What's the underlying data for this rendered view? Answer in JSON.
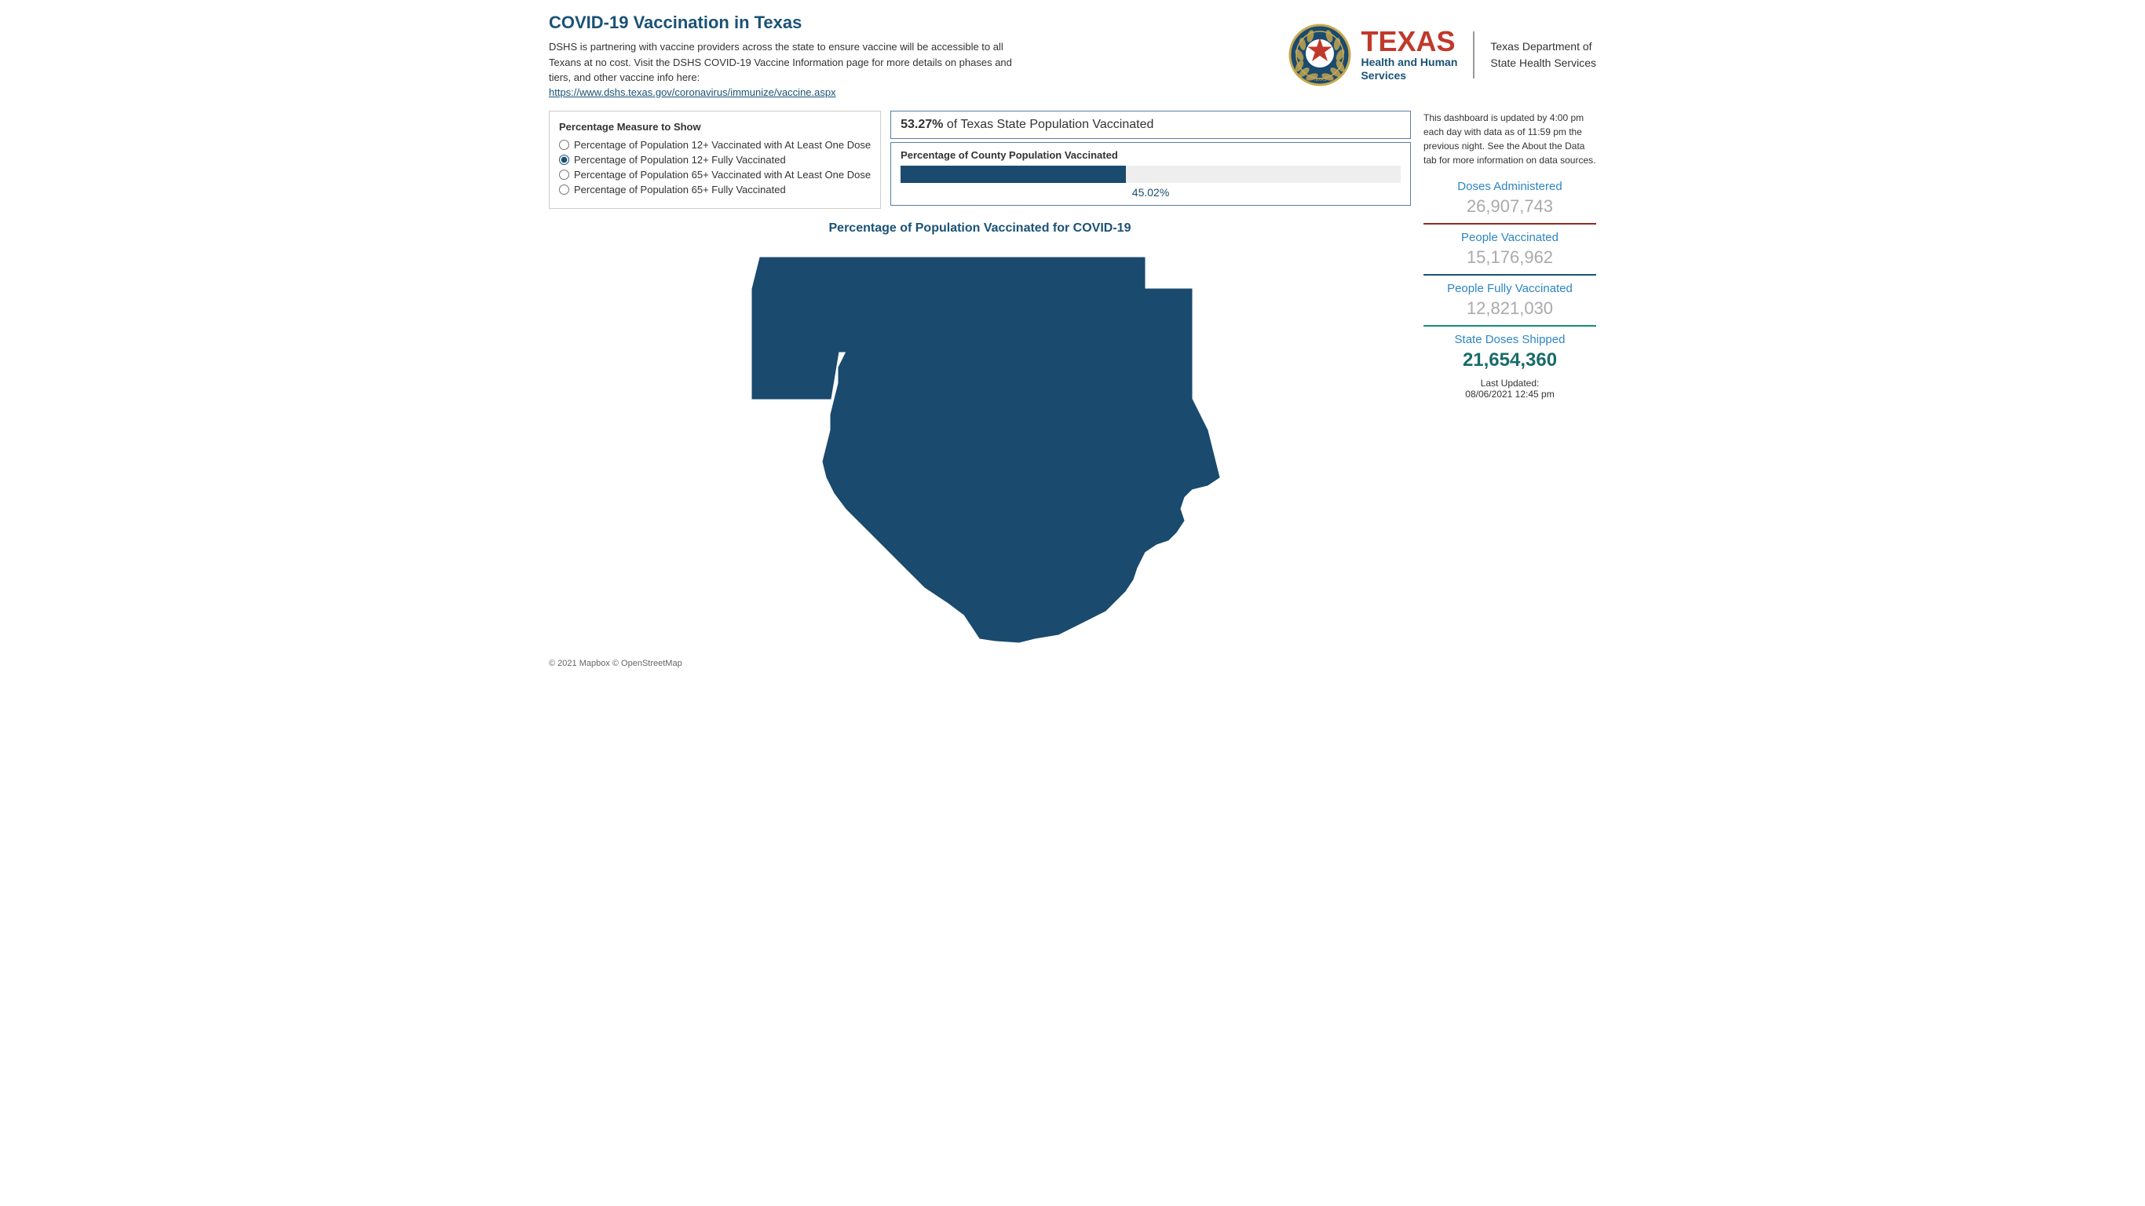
{
  "header": {
    "title": "COVID-19 Vaccination in Texas",
    "description": "DSHS is partnering with vaccine providers across the state to ensure vaccine will be accessible to all Texans at no cost. Visit the DSHS COVID-19 Vaccine Information page for more details on phases and tiers, and other vaccine info here:",
    "link_text": "https://www.dshs.texas.gov/coronavirus/immunize/vaccine.aspx",
    "link_url": "https://www.dshs.texas.gov/coronavirus/immunize/vaccine.aspx"
  },
  "logo": {
    "texas_word": "TEXAS",
    "hhs_line1": "Health and Human",
    "hhs_line2": "Services",
    "dshs_line1": "Texas Department of",
    "dshs_line2": "State Health Services"
  },
  "measure_selector": {
    "title": "Percentage Measure to Show",
    "options": [
      {
        "id": "opt1",
        "label": "Percentage of Population 12+ Vaccinated with At Least One Dose",
        "selected": false
      },
      {
        "id": "opt2",
        "label": "Percentage of Population 12+ Fully Vaccinated",
        "selected": true
      },
      {
        "id": "opt3",
        "label": "Percentage of Population 65+ Vaccinated with At Least One Dose",
        "selected": false
      },
      {
        "id": "opt4",
        "label": "Percentage of Population 65+ Fully Vaccinated",
        "selected": false
      }
    ]
  },
  "state_vaccination": {
    "percent": "53.27%",
    "label": "of Texas State Population Vaccinated"
  },
  "county_vaccination": {
    "label": "Percentage of County Population Vaccinated",
    "bar_percent": 45.02,
    "bar_label": "45.02%"
  },
  "map": {
    "title": "Percentage of Population Vaccinated for COVID-19",
    "copyright": "© 2021 Mapbox © OpenStreetMap"
  },
  "right_panel": {
    "note": "This dashboard is updated by 4:00 pm each day with data as of 11:59 pm the previous night. See the About the Data tab for more information on data sources.",
    "stats": [
      {
        "label": "Doses Administered",
        "value": "26,907,743",
        "divider": "red",
        "bold": false
      },
      {
        "label": "People Vaccinated",
        "value": "15,176,962",
        "divider": "blue",
        "bold": false
      },
      {
        "label": "People Fully Vaccinated",
        "value": "12,821,030",
        "divider": "teal",
        "bold": false
      },
      {
        "label": "State Doses Shipped",
        "value": "21,654,360",
        "divider": null,
        "bold": true
      }
    ],
    "last_updated_label": "Last Updated:",
    "last_updated_value": "08/06/2021 12:45 pm"
  }
}
